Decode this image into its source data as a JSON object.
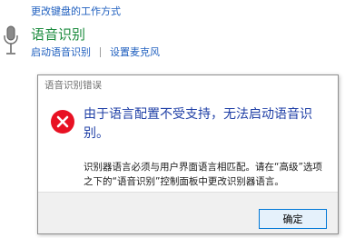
{
  "top_link": "更改键盘的工作方式",
  "speech": {
    "title": "语音识别",
    "links": [
      "启动语音识别",
      "设置麦克风"
    ]
  },
  "dialog": {
    "title": "语音识别错误",
    "main_message": "由于语言配置不受支持，无法启动语音识别。",
    "detail": "识别器语言必须与用户界面语言相匹配。请在“高级”选项之下的“语音识别”控制面板中更改识别器语言。",
    "ok_label": "确定"
  },
  "icons": {
    "microphone": "microphone-icon",
    "error": "error-icon"
  },
  "colors": {
    "link": "#1f5fbf",
    "section_title": "#1a8a3c",
    "main_message": "#1f3fa6",
    "error_red": "#e81123",
    "button_border": "#0078d7"
  }
}
